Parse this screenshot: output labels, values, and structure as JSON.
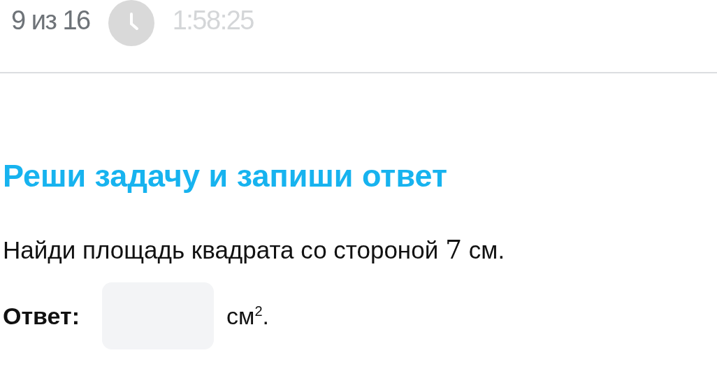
{
  "progress": {
    "counter": "9 из 16",
    "timer": "1:58:25"
  },
  "task": {
    "title": "Реши задачу и запиши ответ",
    "question": {
      "before": "Найди площадь квадрата со стороной ",
      "number": "7",
      "after": " см."
    },
    "answer": {
      "label": "Ответ:",
      "unit": "см$^{2}$."
    }
  }
}
